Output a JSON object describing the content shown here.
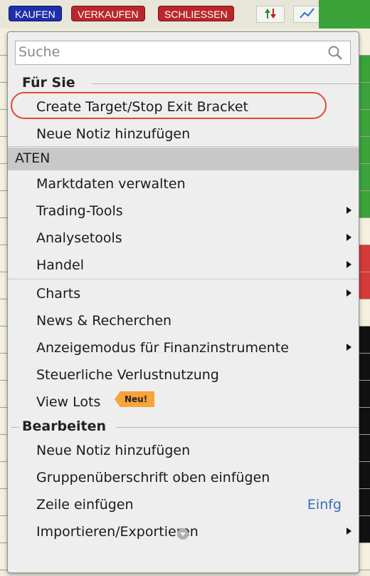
{
  "toolbar": {
    "buy_label": "KAUFEN",
    "sell_label": "VERKAUFEN",
    "close_label": "SCHLIESSEN"
  },
  "menu": {
    "search_placeholder": "Suche",
    "section_for_you": "Für Sie",
    "create_bracket": "Create Target/Stop Exit Bracket",
    "add_note_1": "Neue Notiz hinzufügen",
    "group_aten": "ATEN",
    "manage_market_data": "Marktdaten verwalten",
    "trading_tools": "Trading-Tools",
    "analysis_tools": "Analysetools",
    "trade": "Handel",
    "charts": "Charts",
    "news_research": "News & Recherchen",
    "display_mode": "Anzeigemodus für Finanzinstrumente",
    "tax_loss": "Steuerliche Verlustnutzung",
    "view_lots": "View Lots",
    "new_badge": "Neu!",
    "section_edit": "Bearbeiten",
    "add_note_2": "Neue Notiz hinzufügen",
    "insert_group_header": "Gruppenüberschrift oben einfügen",
    "insert_row": "Zeile einfügen",
    "insert_row_shortcut": "Einfg",
    "import_export": "Importieren/Exportieren"
  },
  "colors": {
    "highlight_outline": "#e2483c",
    "badge": "#f7a43a",
    "shortcut": "#3a6fb8"
  }
}
